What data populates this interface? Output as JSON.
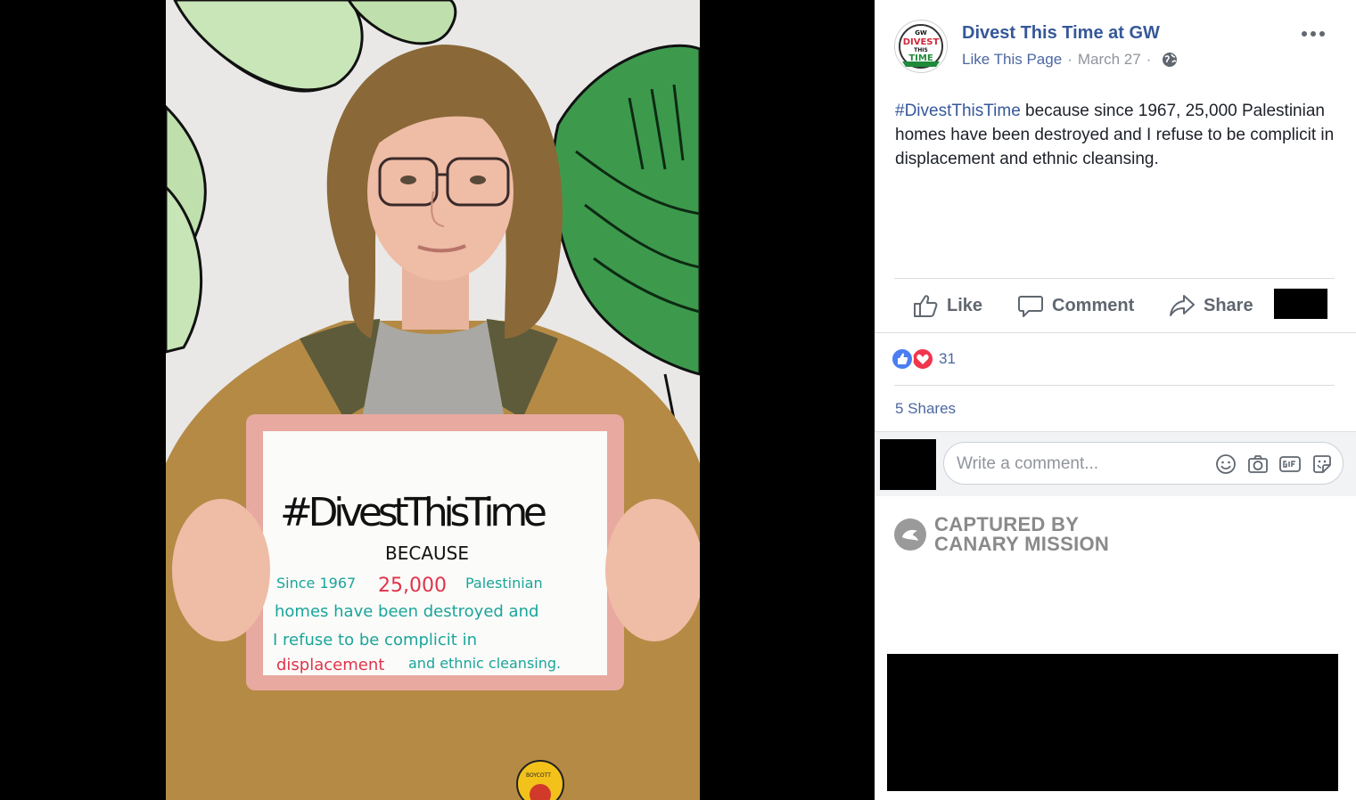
{
  "post": {
    "page_name": "Divest This Time at GW",
    "like_page": "Like This Page",
    "separator": "·",
    "date": "March 27",
    "hashtag": "#DivestThisTime",
    "body": " because since 1967, 25,000 Palestinian homes have been destroyed and I refuse to be complicit in displacement and ethnic cleansing."
  },
  "avatar_logo": {
    "line1": "GW",
    "line2": "DIVEST",
    "line3": "THIS",
    "line4": "TIME"
  },
  "photo": {
    "sign": {
      "headline": "#DivestThisTime",
      "because": "BECAUSE",
      "line1_a": "Since 1967",
      "line1_b": "25,000",
      "line1_c": "Palestinian",
      "line2": "homes have been destroyed and",
      "line3": "I refuse to be complicit in",
      "line4_a": "displacement",
      "line4_b": "and ethnic cleansing."
    },
    "pin_text": "BOYCOTT"
  },
  "actions": {
    "like": "Like",
    "comment": "Comment",
    "share": "Share"
  },
  "stats": {
    "reaction_count": "31",
    "shares": "5 Shares"
  },
  "comment": {
    "placeholder": "Write a comment..."
  },
  "watermark": {
    "line1": "CAPTURED BY",
    "line2": "CANARY MISSION"
  },
  "colors": {
    "link": "#365899",
    "like_blue": "#4a7ef1",
    "love_red": "#f0354c",
    "meta_gray": "#90949c",
    "action_gray": "#606770"
  }
}
